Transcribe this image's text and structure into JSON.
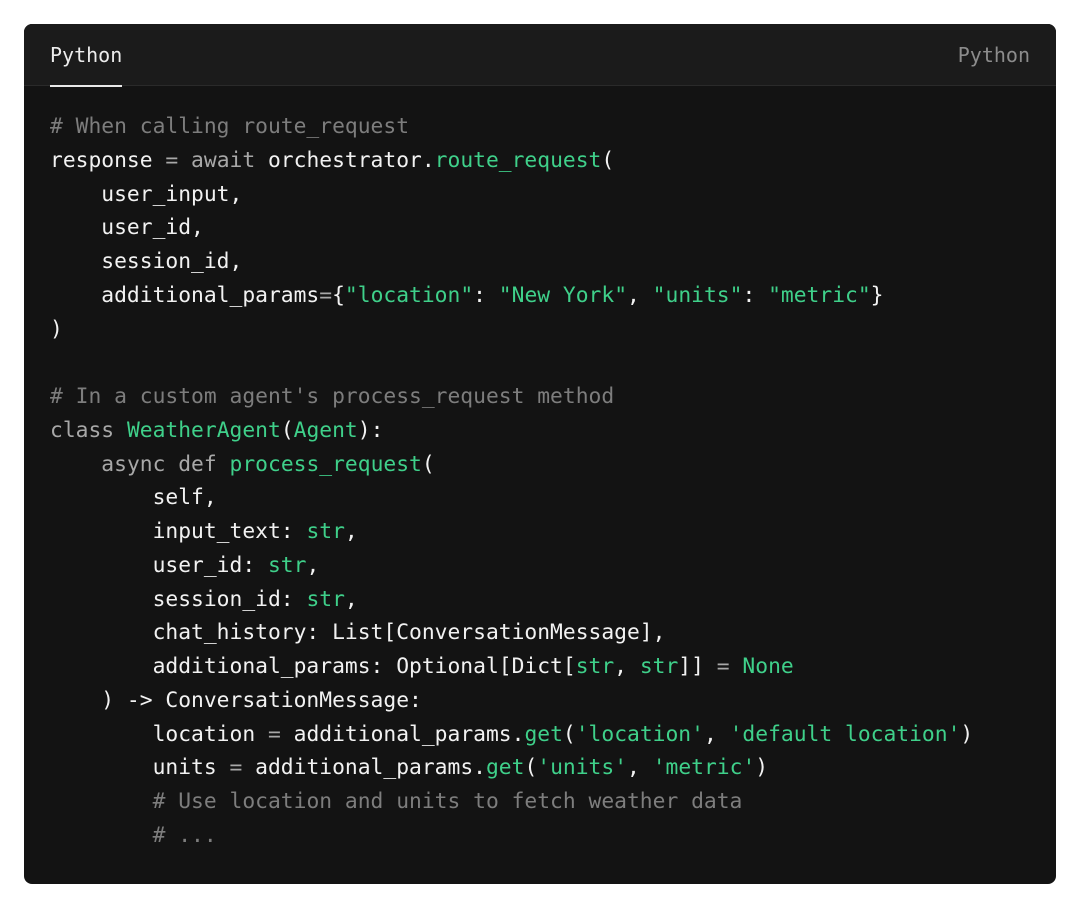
{
  "header": {
    "tab_label": "Python",
    "language_label": "Python"
  },
  "colors": {
    "background": "#131313",
    "header_background": "#1b1b1b",
    "text": "#f2f2f2",
    "comment": "#7d7d7d",
    "keyword": "#a8a8a8",
    "accent_green": "#3fd08a"
  },
  "code_lines": [
    [
      {
        "t": "# When calling route_request",
        "k": "comment"
      }
    ],
    [
      {
        "t": "response",
        "k": "plain"
      },
      {
        "t": " = ",
        "k": "op"
      },
      {
        "t": "await",
        "k": "keyword"
      },
      {
        "t": " orchestrator.",
        "k": "plain"
      },
      {
        "t": "route_request",
        "k": "fn"
      },
      {
        "t": "(",
        "k": "plain"
      }
    ],
    [
      {
        "t": "    user_input,",
        "k": "plain"
      }
    ],
    [
      {
        "t": "    user_id,",
        "k": "plain"
      }
    ],
    [
      {
        "t": "    session_id,",
        "k": "plain"
      }
    ],
    [
      {
        "t": "    additional_params",
        "k": "plain"
      },
      {
        "t": "=",
        "k": "op"
      },
      {
        "t": "{",
        "k": "plain"
      },
      {
        "t": "\"location\"",
        "k": "string"
      },
      {
        "t": ": ",
        "k": "plain"
      },
      {
        "t": "\"New York\"",
        "k": "string"
      },
      {
        "t": ", ",
        "k": "plain"
      },
      {
        "t": "\"units\"",
        "k": "string"
      },
      {
        "t": ": ",
        "k": "plain"
      },
      {
        "t": "\"metric\"",
        "k": "string"
      },
      {
        "t": "}",
        "k": "plain"
      }
    ],
    [
      {
        "t": ")",
        "k": "plain"
      }
    ],
    [],
    [
      {
        "t": "# In a custom agent's process_request method",
        "k": "comment"
      }
    ],
    [
      {
        "t": "class",
        "k": "keyword"
      },
      {
        "t": " ",
        "k": "plain"
      },
      {
        "t": "WeatherAgent",
        "k": "fn"
      },
      {
        "t": "(",
        "k": "plain"
      },
      {
        "t": "Agent",
        "k": "type"
      },
      {
        "t": "):",
        "k": "plain"
      }
    ],
    [
      {
        "t": "    ",
        "k": "plain"
      },
      {
        "t": "async",
        "k": "keyword"
      },
      {
        "t": " ",
        "k": "plain"
      },
      {
        "t": "def",
        "k": "keyword"
      },
      {
        "t": " ",
        "k": "plain"
      },
      {
        "t": "process_request",
        "k": "fn"
      },
      {
        "t": "(",
        "k": "plain"
      }
    ],
    [
      {
        "t": "        self,",
        "k": "plain"
      }
    ],
    [
      {
        "t": "        input_text: ",
        "k": "plain"
      },
      {
        "t": "str",
        "k": "type"
      },
      {
        "t": ",",
        "k": "plain"
      }
    ],
    [
      {
        "t": "        user_id: ",
        "k": "plain"
      },
      {
        "t": "str",
        "k": "type"
      },
      {
        "t": ",",
        "k": "plain"
      }
    ],
    [
      {
        "t": "        session_id: ",
        "k": "plain"
      },
      {
        "t": "str",
        "k": "type"
      },
      {
        "t": ",",
        "k": "plain"
      }
    ],
    [
      {
        "t": "        chat_history: List[ConversationMessage],",
        "k": "plain"
      }
    ],
    [
      {
        "t": "        additional_params: Optional[Dict[",
        "k": "plain"
      },
      {
        "t": "str",
        "k": "type"
      },
      {
        "t": ", ",
        "k": "plain"
      },
      {
        "t": "str",
        "k": "type"
      },
      {
        "t": "]] ",
        "k": "plain"
      },
      {
        "t": "=",
        "k": "op"
      },
      {
        "t": " ",
        "k": "plain"
      },
      {
        "t": "None",
        "k": "type"
      }
    ],
    [
      {
        "t": "    ) -> ConversationMessage:",
        "k": "plain"
      }
    ],
    [
      {
        "t": "        location ",
        "k": "plain"
      },
      {
        "t": "=",
        "k": "op"
      },
      {
        "t": " additional_params.",
        "k": "plain"
      },
      {
        "t": "get",
        "k": "fn"
      },
      {
        "t": "(",
        "k": "plain"
      },
      {
        "t": "'location'",
        "k": "string"
      },
      {
        "t": ", ",
        "k": "plain"
      },
      {
        "t": "'default location'",
        "k": "string"
      },
      {
        "t": ")",
        "k": "plain"
      }
    ],
    [
      {
        "t": "        units ",
        "k": "plain"
      },
      {
        "t": "=",
        "k": "op"
      },
      {
        "t": " additional_params.",
        "k": "plain"
      },
      {
        "t": "get",
        "k": "fn"
      },
      {
        "t": "(",
        "k": "plain"
      },
      {
        "t": "'units'",
        "k": "string"
      },
      {
        "t": ", ",
        "k": "plain"
      },
      {
        "t": "'metric'",
        "k": "string"
      },
      {
        "t": ")",
        "k": "plain"
      }
    ],
    [
      {
        "t": "        ",
        "k": "plain"
      },
      {
        "t": "# Use location and units to fetch weather data",
        "k": "comment"
      }
    ],
    [
      {
        "t": "        ",
        "k": "plain"
      },
      {
        "t": "# ...",
        "k": "comment"
      }
    ]
  ]
}
